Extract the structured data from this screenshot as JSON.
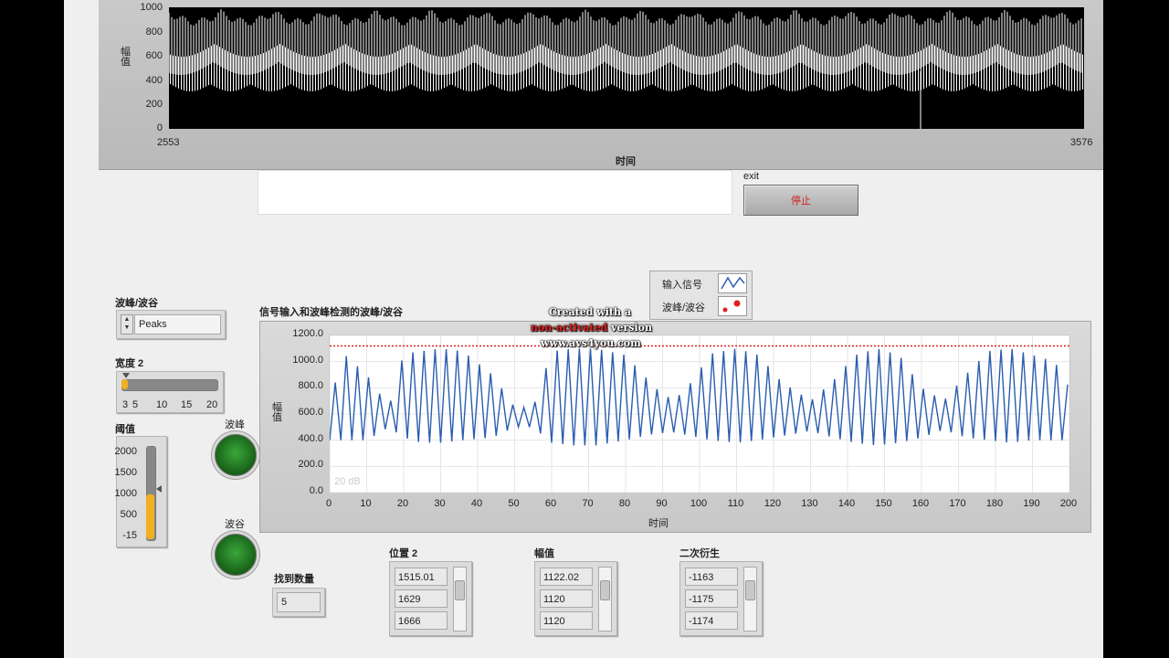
{
  "top_graph": {
    "y_ticks": [
      "1000",
      "800",
      "600",
      "400",
      "200",
      "0"
    ],
    "y_label": "幅值",
    "x_min": "2553",
    "x_max": "3576",
    "x_label": "时间"
  },
  "exit_label": "exit",
  "stop_button": "停止",
  "peak_valley": {
    "label": "波峰/波谷",
    "value": "Peaks"
  },
  "width": {
    "label": "宽度 2",
    "ticks": [
      "3",
      "5",
      "10",
      "15",
      "20"
    ],
    "value": 3
  },
  "threshold": {
    "label": "阈值",
    "ticks": [
      "2000",
      "1500",
      "1000",
      "500",
      "-15"
    ],
    "fill_percent": 48
  },
  "leds": {
    "peak": "波峰",
    "valley": "波谷"
  },
  "found_count": {
    "label": "找到数量",
    "value": "5"
  },
  "chart_title": "信号输入和波峰检测的波峰/波谷",
  "legend": {
    "items": [
      {
        "name": "输入信号"
      },
      {
        "name": "波峰/波谷"
      }
    ]
  },
  "plot_overlay": "20 dB",
  "chart_data": {
    "type": "line",
    "title": "信号输入和波峰检测的波峰/波谷",
    "xlabel": "时间",
    "ylabel": "幅值",
    "xlim": [
      0,
      200
    ],
    "ylim": [
      0,
      1200
    ],
    "x_ticks": [
      "0",
      "10",
      "20",
      "30",
      "40",
      "50",
      "60",
      "70",
      "80",
      "90",
      "100",
      "110",
      "120",
      "130",
      "140",
      "150",
      "160",
      "170",
      "180",
      "190",
      "200"
    ],
    "y_ticks": [
      "1200.0",
      "1000.0",
      "800.0",
      "600.0",
      "400.0",
      "200.0",
      "0.0"
    ],
    "threshold_line": 1120,
    "series": [
      {
        "name": "输入信号",
        "color": "#2a5db0"
      }
    ],
    "period": 3,
    "envelope": [
      [
        0,
        600,
        400
      ],
      [
        3,
        1080,
        400
      ],
      [
        10,
        900,
        400
      ],
      [
        16,
        650,
        500
      ],
      [
        20,
        1060,
        420
      ],
      [
        25,
        1080,
        380
      ],
      [
        30,
        1100,
        380
      ],
      [
        36,
        1080,
        400
      ],
      [
        44,
        900,
        420
      ],
      [
        50,
        650,
        500
      ],
      [
        55,
        650,
        500
      ],
      [
        60,
        1080,
        380
      ],
      [
        66,
        1100,
        360
      ],
      [
        72,
        1100,
        360
      ],
      [
        80,
        1050,
        400
      ],
      [
        88,
        800,
        450
      ],
      [
        93,
        700,
        460
      ],
      [
        98,
        850,
        430
      ],
      [
        103,
        1060,
        400
      ],
      [
        110,
        1100,
        380
      ],
      [
        116,
        1050,
        400
      ],
      [
        122,
        850,
        430
      ],
      [
        130,
        700,
        470
      ],
      [
        136,
        850,
        420
      ],
      [
        142,
        1050,
        380
      ],
      [
        148,
        1100,
        360
      ],
      [
        154,
        1050,
        380
      ],
      [
        160,
        800,
        420
      ],
      [
        166,
        700,
        480
      ],
      [
        172,
        900,
        420
      ],
      [
        178,
        1080,
        400
      ],
      [
        184,
        1100,
        380
      ],
      [
        190,
        1050,
        400
      ],
      [
        196,
        1000,
        400
      ],
      [
        200,
        800,
        400
      ]
    ]
  },
  "arrays": [
    {
      "label": "位置 2",
      "values": [
        "1515.01",
        "1629",
        "1666"
      ]
    },
    {
      "label": "幅值",
      "values": [
        "1122.02",
        "1120",
        "1120"
      ]
    },
    {
      "label": "二次衍生",
      "values": [
        "-1163",
        "-1175",
        "-1174"
      ]
    }
  ],
  "watermark": {
    "line1": "Created with a",
    "line2a": "non-activated",
    "line2b": "version",
    "line3": "www.avs4you.com"
  }
}
